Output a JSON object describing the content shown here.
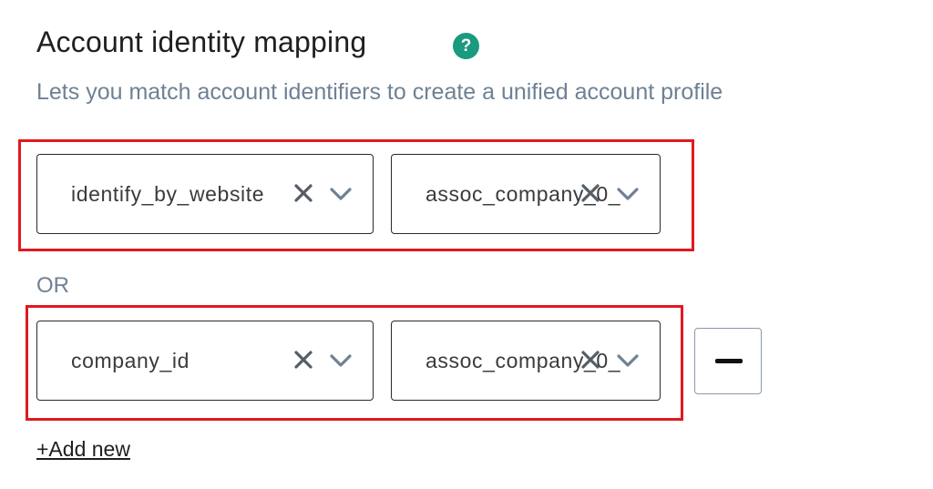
{
  "section": {
    "title": "Account identity mapping",
    "help_icon": "question-mark-icon",
    "help_icon_glyph": "?",
    "subtitle": "Lets you match account identifiers to create a unified account profile"
  },
  "mappings": [
    {
      "left_value": "identify_by_website",
      "right_value": "assoc_company_0_",
      "highlighted": true
    },
    {
      "left_value": "company_id",
      "right_value": "assoc_company_0_",
      "highlighted": true
    }
  ],
  "or_label": "OR",
  "add_new_label": "+Add new",
  "colors": {
    "accent": "#1a9a7e",
    "highlight": "#e0191f",
    "muted_text": "#6f8194"
  }
}
